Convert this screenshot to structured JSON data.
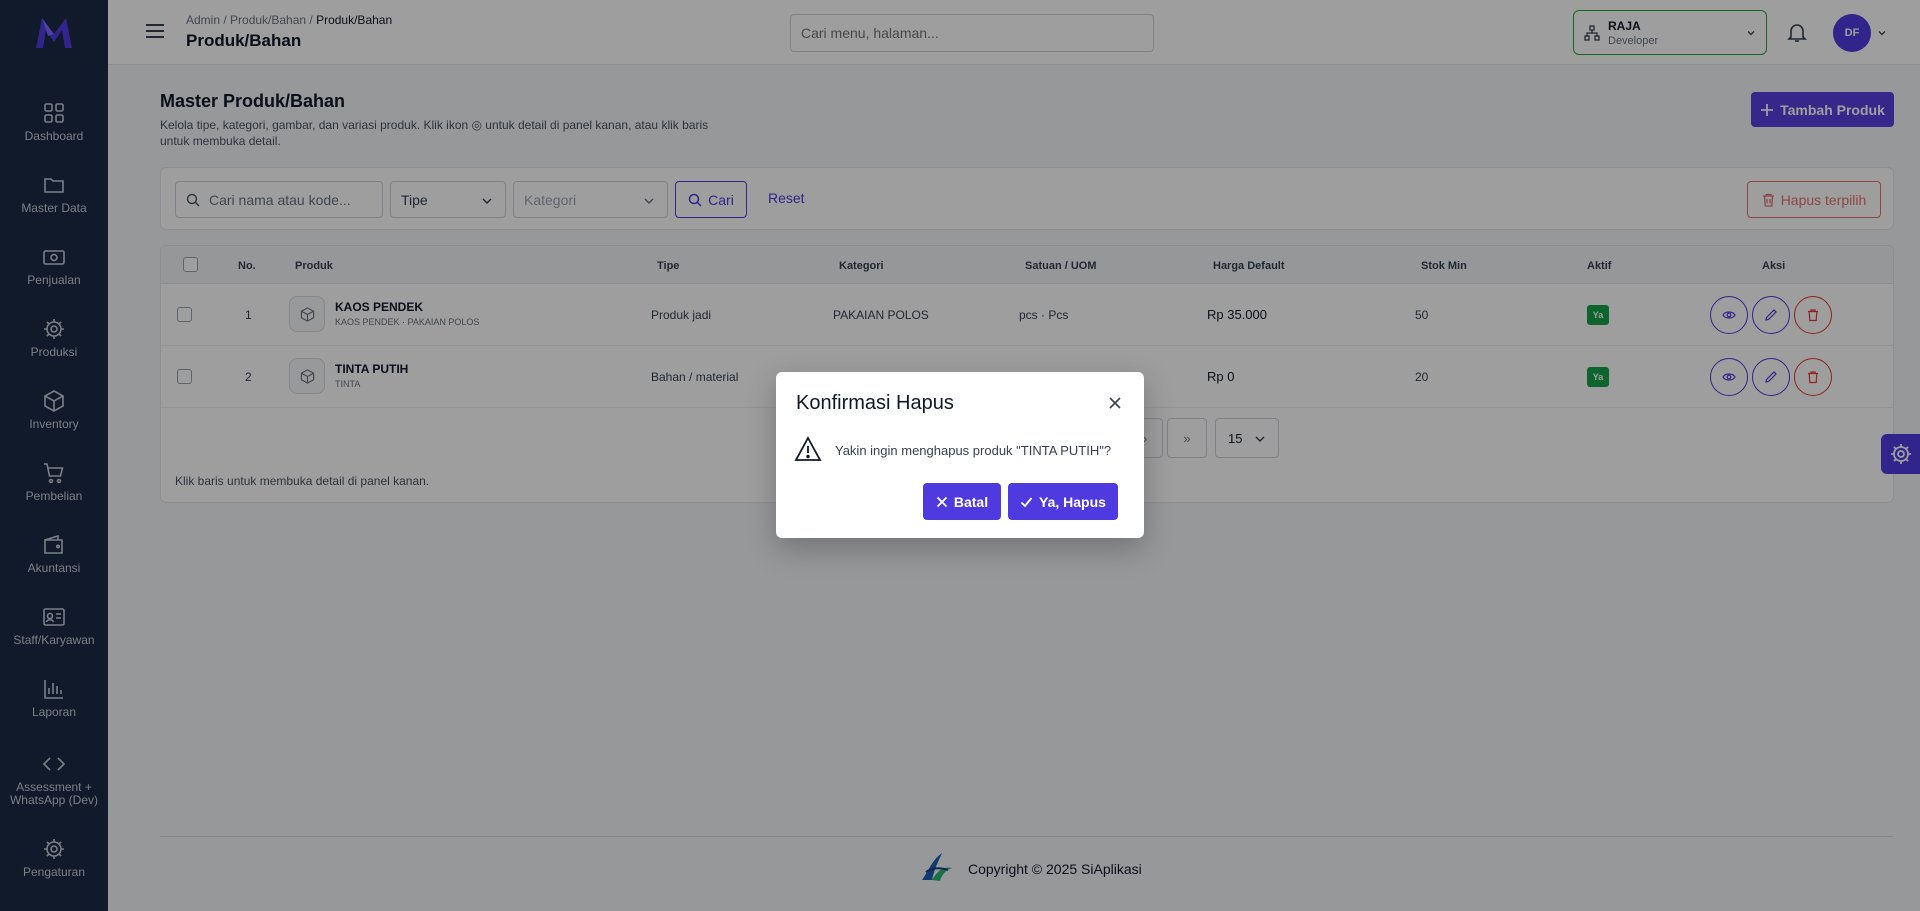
{
  "sidebar": {
    "items": [
      {
        "label": "Dashboard",
        "icon": "grid-icon"
      },
      {
        "label": "Master Data",
        "icon": "folder-icon"
      },
      {
        "label": "Penjualan",
        "icon": "cash-icon"
      },
      {
        "label": "Produksi",
        "icon": "gear-icon"
      },
      {
        "label": "Inventory",
        "icon": "box-icon"
      },
      {
        "label": "Pembelian",
        "icon": "cart-icon"
      },
      {
        "label": "Akuntansi",
        "icon": "wallet-icon"
      },
      {
        "label": "Staff/Karyawan",
        "icon": "id-card-icon"
      },
      {
        "label": "Laporan",
        "icon": "bar-chart-icon"
      },
      {
        "label": "Assessment + WhatsApp (Dev)",
        "icon": "code-icon"
      },
      {
        "label": "Pengaturan",
        "icon": "gear-icon"
      }
    ]
  },
  "header": {
    "breadcrumb_prefix": "Admin / Produk/Bahan / ",
    "breadcrumb_current": "Produk/Bahan",
    "title": "Produk/Bahan",
    "search_placeholder": "Cari menu, halaman...",
    "tenant_name": "RAJA",
    "tenant_role": "Developer",
    "avatar_initials": "DF"
  },
  "main": {
    "title": "Master Produk/Bahan",
    "description": "Kelola tipe, kategori, gambar, dan variasi produk. Klik ikon ◎ untuk detail di panel kanan, atau klik baris untuk membuka detail.",
    "add_button": "Tambah Produk"
  },
  "filters": {
    "search_placeholder": "Cari nama atau kode...",
    "type_label": "Tipe",
    "category_label": "Kategori",
    "search_button": "Cari",
    "reset_link": "Reset",
    "delete_selected": "Hapus terpilih"
  },
  "table": {
    "columns": [
      "No.",
      "Produk",
      "Tipe",
      "Kategori",
      "Satuan / UOM",
      "Harga Default",
      "Stok Min",
      "Aktif",
      "Aksi"
    ],
    "rows": [
      {
        "no": "1",
        "name": "KAOS PENDEK",
        "sub": "KAOS PENDEK · PAKAIAN POLOS",
        "type": "Produk jadi",
        "category": "PAKAIAN POLOS",
        "uom": "pcs · Pcs",
        "price": "Rp 35.000",
        "min_stock": "50",
        "active": "Ya"
      },
      {
        "no": "2",
        "name": "TINTA PUTIH",
        "sub": "TINTA",
        "type": "Bahan / material",
        "category": "",
        "uom": "",
        "price": "Rp 0",
        "min_stock": "20",
        "active": "Ya"
      }
    ],
    "pager_next": "›",
    "pager_last": "»",
    "page_size": "15",
    "hint": "Klik baris untuk membuka detail di panel kanan."
  },
  "footer": {
    "text": "Copyright © 2025 SiAplikasi"
  },
  "modal": {
    "title": "Konfirmasi Hapus",
    "message": "Yakin ingin menghapus produk \"TINTA PUTIH\"?",
    "cancel": "Batal",
    "confirm": "Ya, Hapus"
  },
  "colors": {
    "sidebar_bg": "#1c2b45",
    "accent": "#4f3ae0",
    "success": "#16a34a",
    "danger": "#e53935",
    "tenant_border": "#28a745"
  }
}
